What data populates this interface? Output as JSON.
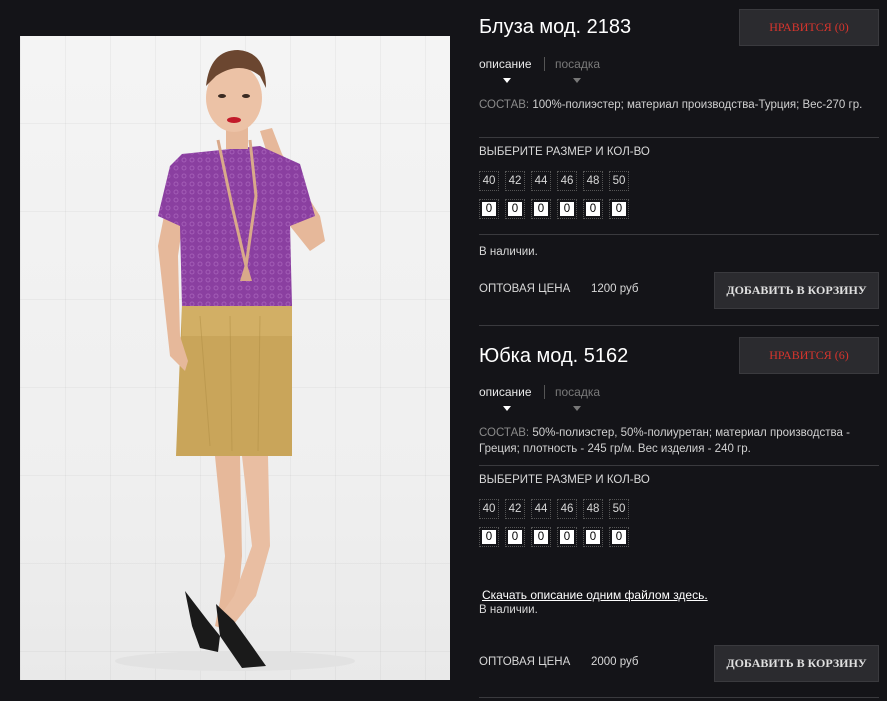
{
  "products": [
    {
      "title": "Блуза мод. 2183",
      "like_label": "НРАВИТСЯ (0)",
      "tab_description": "описание",
      "tab_fit": "посадка",
      "composition_label": "СОСТАВ:",
      "composition_text": "100%-полиэстер; материал производства-Турция; Вес-270 гр.",
      "size_title": "ВЫБЕРИТЕ РАЗМЕР И КОЛ-ВО",
      "sizes": [
        "40",
        "42",
        "44",
        "46",
        "48",
        "50"
      ],
      "quantities": [
        "0",
        "0",
        "0",
        "0",
        "0",
        "0"
      ],
      "stock": "В наличии.",
      "price_label": "ОПТОВАЯ ЦЕНА",
      "price_value": "1200 руб",
      "cart_label": "ДОБАВИТЬ В КОРЗИНУ"
    },
    {
      "title": "Юбка мод. 5162",
      "like_label": "НРАВИТСЯ (6)",
      "tab_description": "описание",
      "tab_fit": "посадка",
      "composition_label": "СОСТАВ:",
      "composition_text": "50%-полиэстер, 50%-полиуретан; материал производства - Греция; плотность - 245 гр/м. Вес изделия - 240 гр.",
      "size_title": "ВЫБЕРИТЕ РАЗМЕР И КОЛ-ВО",
      "sizes": [
        "40",
        "42",
        "44",
        "46",
        "48",
        "50"
      ],
      "quantities": [
        "0",
        "0",
        "0",
        "0",
        "0",
        "0"
      ],
      "download_link": "Скачать описание одним файлом здесь.",
      "stock": "В наличии.",
      "price_label": "ОПТОВАЯ ЦЕНА",
      "price_value": "2000 руб",
      "cart_label": "ДОБАВИТЬ В КОРЗИНУ"
    }
  ],
  "colors": {
    "background": "#141418",
    "like_text": "#d8352d",
    "button_bg": "#2b2b2f"
  }
}
